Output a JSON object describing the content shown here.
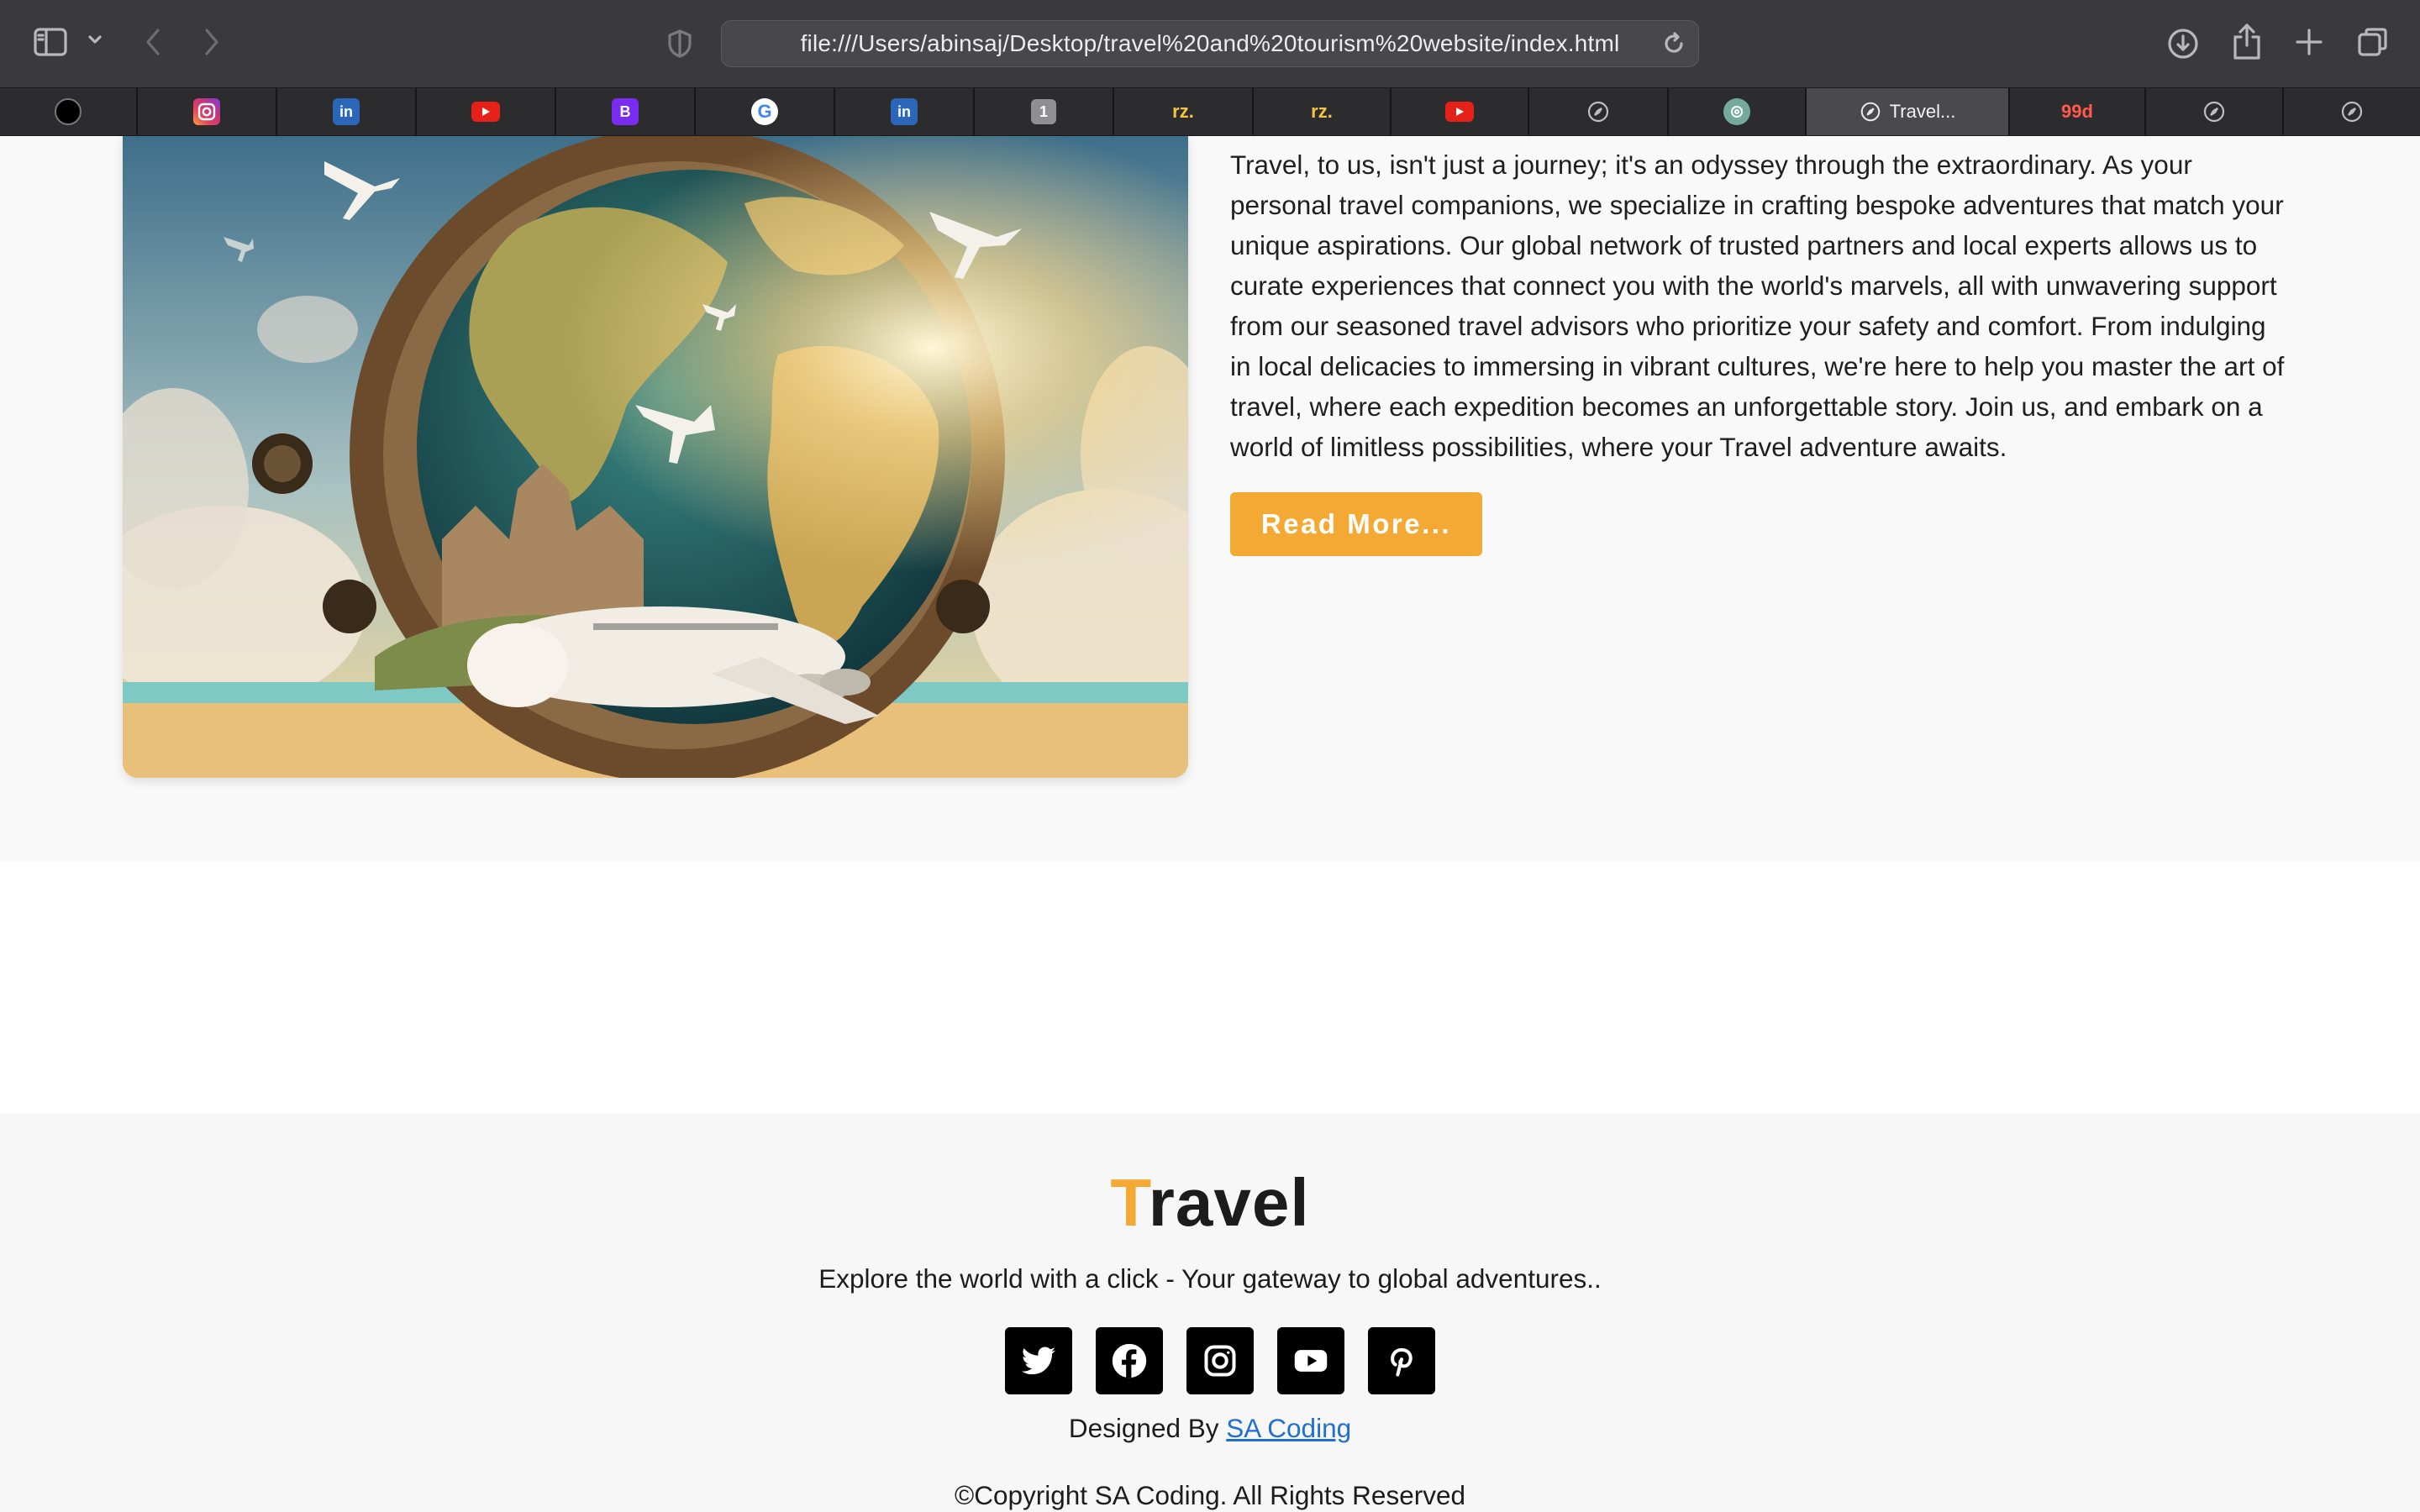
{
  "browser": {
    "url": "file:///Users/abinsaj/Desktop/travel%20and%20tourism%20website/index.html",
    "tabs": [
      {
        "icon": "account-avatar-icon",
        "label": ""
      },
      {
        "icon": "instagram-icon",
        "label": ""
      },
      {
        "icon": "linkedin-icon",
        "label": ""
      },
      {
        "icon": "youtube-icon",
        "label": ""
      },
      {
        "icon": "bootstrap-icon",
        "label": "B"
      },
      {
        "icon": "google-icon",
        "label": "G"
      },
      {
        "icon": "linkedin-icon",
        "label": ""
      },
      {
        "icon": "number-badge-icon",
        "label": "1"
      },
      {
        "icon": "rz-icon",
        "label": "rz."
      },
      {
        "icon": "rz-icon",
        "label": "rz."
      },
      {
        "icon": "youtube-icon",
        "label": ""
      },
      {
        "icon": "compass-icon",
        "label": ""
      },
      {
        "icon": "chatgpt-icon",
        "label": ""
      },
      {
        "icon": "compass-icon",
        "label": "Travel..."
      },
      {
        "icon": "99designs-icon",
        "label": "99d"
      },
      {
        "icon": "compass-icon",
        "label": ""
      },
      {
        "icon": "compass-icon",
        "label": ""
      }
    ],
    "active_tab_index": 13
  },
  "about": {
    "paragraph": "Travel, to us, isn't just a journey; it's an odyssey through the extraordinary. As your personal travel companions, we specialize in crafting bespoke adventures that match your unique aspirations. Our global network of trusted partners and local experts allows us to curate experiences that connect you with the world's marvels, all with unwavering support from our seasoned travel advisors who prioritize your safety and comfort. From indulging in local delicacies to immersing in vibrant cultures, we're here to help you master the art of travel, where each expedition becomes an unforgettable story. Join us, and embark on a world of limitless possibilities, where your Travel adventure awaits.",
    "button_label": "Read More..."
  },
  "footer": {
    "logo_first": "T",
    "logo_rest": "ravel",
    "tagline": "Explore the world with a click - Your gateway to global adventures..",
    "socials": [
      "twitter-icon",
      "facebook-icon",
      "instagram-icon",
      "youtube-icon",
      "pinterest-icon"
    ],
    "designed_prefix": "Designed By ",
    "designed_link": "SA Coding",
    "copyright": "©Copyright SA Coding. All Rights Reserved"
  },
  "colors": {
    "accent": "#f3a934",
    "link": "#1f6fd1"
  }
}
